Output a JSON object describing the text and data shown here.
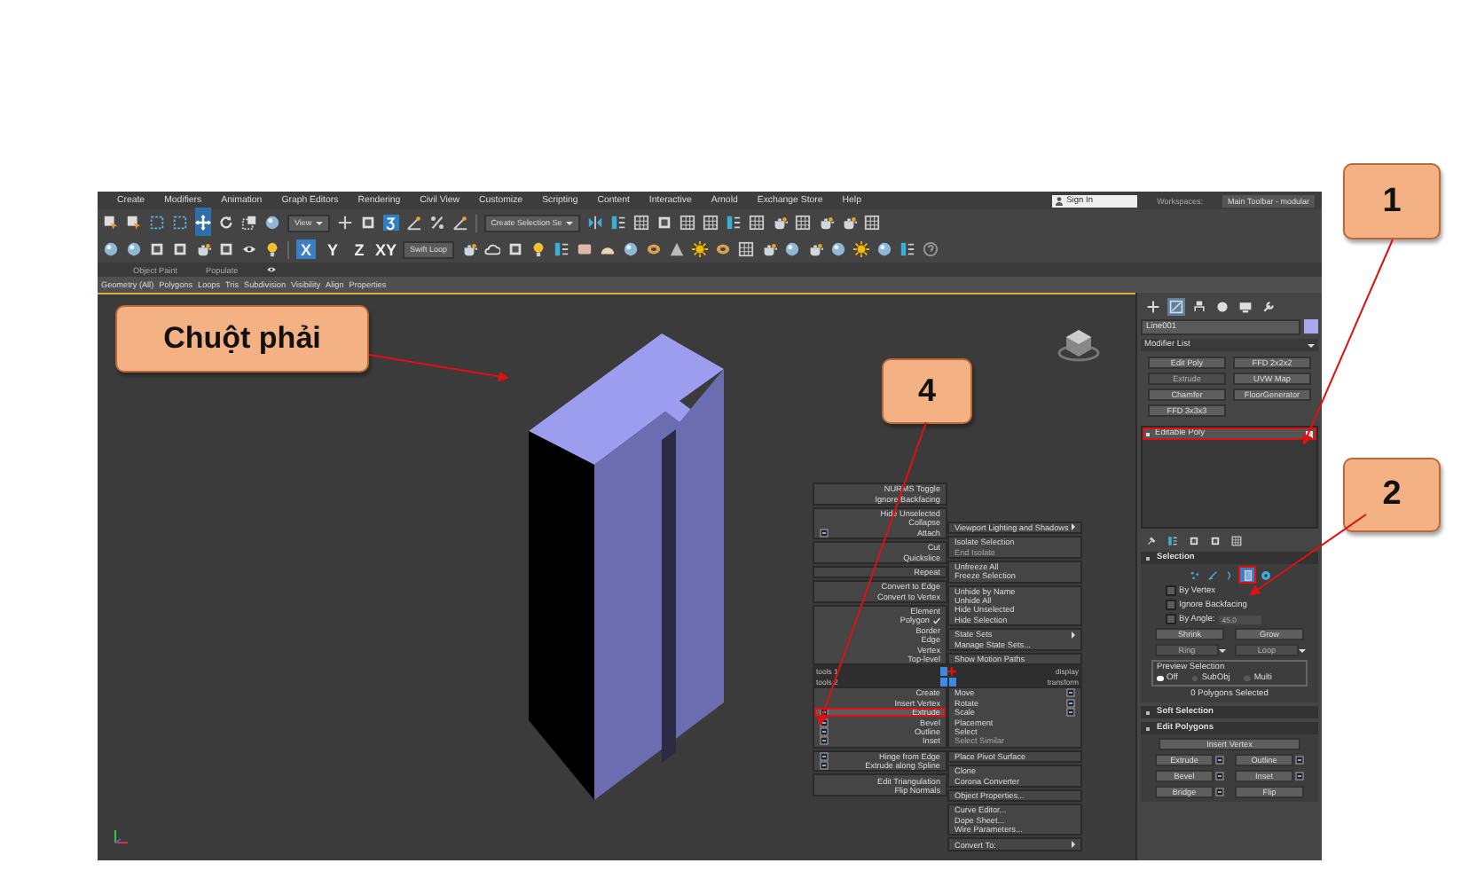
{
  "callouts": [
    {
      "label": "Chuột phải"
    },
    {
      "label": "1"
    },
    {
      "label": "2"
    },
    {
      "label": "4"
    }
  ],
  "menu_bar": {
    "items": [
      "Create",
      "Modifiers",
      "Animation",
      "Graph Editors",
      "Rendering",
      "Civil View",
      "Customize",
      "Scripting",
      "Content",
      "Interactive",
      "Arnold",
      "Exchange Store",
      "Help"
    ],
    "sign_in": "Sign In",
    "workspaces_label": "Workspaces:",
    "workspace": "Main Toolbar - modular"
  },
  "main_toolbar": {
    "reference_dropdown": "View",
    "selection_set": "Create Selection Se"
  },
  "toolbar_2": {
    "axes": [
      {
        "label": "X",
        "selected": true
      },
      {
        "label": "Y",
        "selected": false
      },
      {
        "label": "Z",
        "selected": false
      },
      {
        "label": "XY",
        "selected": false
      }
    ],
    "swift_loop": "Swift Loop"
  },
  "ribbon": {
    "tabs": [
      "Object Paint",
      "Populate"
    ],
    "items": [
      "Geometry (All)",
      "Polygons",
      "Loops",
      "Tris",
      "Subdivision",
      "Visibility",
      "Align",
      "Properties"
    ]
  },
  "quad_menu": {
    "tools_1": {
      "title": "tools 1",
      "groups": [
        [
          {
            "label": "NURMS Toggle",
            "checked": false,
            "settings": false
          },
          {
            "label": "Ignore Backfacing",
            "checked": false,
            "settings": false
          }
        ],
        [
          {
            "label": "Hide Unselected",
            "checked": false,
            "settings": false
          },
          {
            "label": "Collapse",
            "checked": false,
            "settings": false
          },
          {
            "label": "Attach",
            "checked": false,
            "settings": true
          }
        ],
        [
          {
            "label": "Cut",
            "checked": false,
            "settings": false
          },
          {
            "label": "Quickslice",
            "checked": false,
            "settings": false
          }
        ],
        [
          {
            "label": "Repeat",
            "checked": false,
            "settings": false
          }
        ],
        [
          {
            "label": "Convert to Edge",
            "checked": false,
            "settings": false
          },
          {
            "label": "Convert to Vertex",
            "checked": false,
            "settings": false
          }
        ],
        [
          {
            "label": "Element",
            "checked": false,
            "settings": false
          },
          {
            "label": "Polygon",
            "checked": true,
            "settings": false
          },
          {
            "label": "Border",
            "checked": false,
            "settings": false
          },
          {
            "label": "Edge",
            "checked": false,
            "settings": false
          },
          {
            "label": "Vertex",
            "checked": false,
            "settings": false
          },
          {
            "label": "Top-level",
            "checked": false,
            "settings": false
          }
        ]
      ]
    },
    "display": {
      "title": "display",
      "groups": [
        [
          {
            "label": "Viewport Lighting and Shadows",
            "disabled": false,
            "submenu": true
          }
        ],
        [
          {
            "label": "Isolate Selection",
            "disabled": false,
            "submenu": false
          },
          {
            "label": "End Isolate",
            "disabled": true,
            "submenu": false
          }
        ],
        [
          {
            "label": "Unfreeze All",
            "disabled": false,
            "submenu": false
          },
          {
            "label": "Freeze Selection",
            "disabled": false,
            "submenu": false
          }
        ],
        [
          {
            "label": "Unhide by Name",
            "disabled": false,
            "submenu": false
          },
          {
            "label": "Unhide All",
            "disabled": false,
            "submenu": false
          },
          {
            "label": "Hide Unselected",
            "disabled": false,
            "submenu": false
          },
          {
            "label": "Hide Selection",
            "disabled": false,
            "submenu": false
          }
        ],
        [
          {
            "label": "State Sets",
            "disabled": false,
            "submenu": true
          },
          {
            "label": "Manage State Sets...",
            "disabled": false,
            "submenu": false
          }
        ],
        [
          {
            "label": "Show Motion Paths",
            "disabled": false,
            "submenu": false
          }
        ]
      ]
    },
    "tools_2": {
      "title": "tools 2",
      "groups": [
        [
          {
            "label": "Create",
            "selected": false,
            "settings": false
          },
          {
            "label": "Insert Vertex",
            "selected": false,
            "settings": false
          },
          {
            "label": "Extrude",
            "selected": true,
            "settings": true
          },
          {
            "label": "Bevel",
            "selected": false,
            "settings": true
          },
          {
            "label": "Outline",
            "selected": false,
            "settings": true
          },
          {
            "label": "Inset",
            "selected": false,
            "settings": true
          }
        ],
        [
          {
            "label": "Hinge from Edge",
            "selected": false,
            "settings": true
          },
          {
            "label": "Extrude along Spline",
            "selected": false,
            "settings": true
          }
        ],
        [
          {
            "label": "Edit Triangulation",
            "selected": false,
            "settings": false
          },
          {
            "label": "Flip Normals",
            "selected": false,
            "settings": false
          }
        ]
      ]
    },
    "transform": {
      "title": "transform",
      "groups": [
        [
          {
            "label": "Move",
            "disabled": false,
            "submenu": false,
            "settings": true
          },
          {
            "label": "Rotate",
            "disabled": false,
            "submenu": false,
            "settings": true
          },
          {
            "label": "Scale",
            "disabled": false,
            "submenu": false,
            "settings": true
          },
          {
            "label": "Placement",
            "disabled": false,
            "submenu": false,
            "settings": false
          },
          {
            "label": "Select",
            "disabled": false,
            "submenu": false,
            "settings": false
          },
          {
            "label": "Select Similar",
            "disabled": true,
            "submenu": false,
            "settings": false
          }
        ],
        [
          {
            "label": "Place Pivot Surface",
            "disabled": false,
            "submenu": false,
            "settings": false
          }
        ],
        [
          {
            "label": "Clone",
            "disabled": false,
            "submenu": false,
            "settings": false
          },
          {
            "label": "Corona Converter",
            "disabled": false,
            "submenu": false,
            "settings": false
          }
        ],
        [
          {
            "label": "Object Properties...",
            "disabled": false,
            "submenu": false,
            "settings": false
          }
        ],
        [
          {
            "label": "Curve Editor...",
            "disabled": false,
            "submenu": false,
            "settings": false
          },
          {
            "label": "Dope Sheet...",
            "disabled": false,
            "submenu": false,
            "settings": false
          },
          {
            "label": "Wire Parameters...",
            "disabled": false,
            "submenu": false,
            "settings": false
          }
        ],
        [
          {
            "label": "Convert To:",
            "disabled": false,
            "submenu": true,
            "settings": false
          }
        ]
      ]
    }
  },
  "command_panel": {
    "tabs": [
      {
        "kind": "create",
        "selected": false
      },
      {
        "kind": "modify",
        "selected": true
      },
      {
        "kind": "hierarchy",
        "selected": false
      },
      {
        "kind": "motion",
        "selected": false
      },
      {
        "kind": "display",
        "selected": false
      },
      {
        "kind": "utilities",
        "selected": false
      }
    ],
    "object_name": "Line001",
    "modifier_list": "Modifier List",
    "modifier_buttons": [
      {
        "label": "Edit Poly",
        "disabled": false
      },
      {
        "label": "FFD 2x2x2",
        "disabled": false
      },
      {
        "label": "Extrude",
        "disabled": true
      },
      {
        "label": "UVW Map",
        "disabled": false
      },
      {
        "label": "Chamfer",
        "disabled": false
      },
      {
        "label": "FloorGenerator",
        "disabled": false
      },
      {
        "label": "FFD 3x3x3",
        "disabled": false
      }
    ],
    "stack": [
      {
        "label": "Editable Poly",
        "selected": true,
        "annotated": true
      }
    ],
    "selection": {
      "title": "Selection",
      "levels": [
        {
          "kind": "vertex",
          "selected": false,
          "annotated": false
        },
        {
          "kind": "edge",
          "selected": false,
          "annotated": false
        },
        {
          "kind": "border",
          "selected": false,
          "annotated": false
        },
        {
          "kind": "polygon",
          "selected": true,
          "annotated": true
        },
        {
          "kind": "element",
          "selected": false,
          "annotated": false
        }
      ],
      "options": [
        {
          "label": "By Vertex",
          "checked": false
        },
        {
          "label": "Ignore Backfacing",
          "checked": false
        }
      ],
      "by_angle": {
        "label": "By Angle:",
        "checked": false,
        "value": "45.0"
      },
      "buttons": [
        {
          "label": "Shrink",
          "disabled": false,
          "spinner": false
        },
        {
          "label": "Grow",
          "disabled": false,
          "spinner": false
        },
        {
          "label": "Ring",
          "disabled": true,
          "spinner": true
        },
        {
          "label": "Loop",
          "disabled": true,
          "spinner": true
        }
      ],
      "preview": {
        "title": "Preview Selection",
        "options": [
          {
            "label": "Off",
            "selected": true
          },
          {
            "label": "SubObj",
            "selected": false
          },
          {
            "label": "Multi",
            "selected": false
          }
        ]
      },
      "status": "0 Polygons Selected"
    },
    "soft_selection": {
      "title": "Soft Selection"
    },
    "edit_polygons": {
      "title": "Edit Polygons",
      "insert_vertex": "Insert Vertex",
      "buttons": [
        {
          "label": "Extrude",
          "settings": true
        },
        {
          "label": "Outline",
          "settings": true
        },
        {
          "label": "Bevel",
          "settings": true
        },
        {
          "label": "Inset",
          "settings": true
        },
        {
          "label": "Bridge",
          "settings": true
        },
        {
          "label": "Flip",
          "settings": false
        }
      ]
    }
  }
}
